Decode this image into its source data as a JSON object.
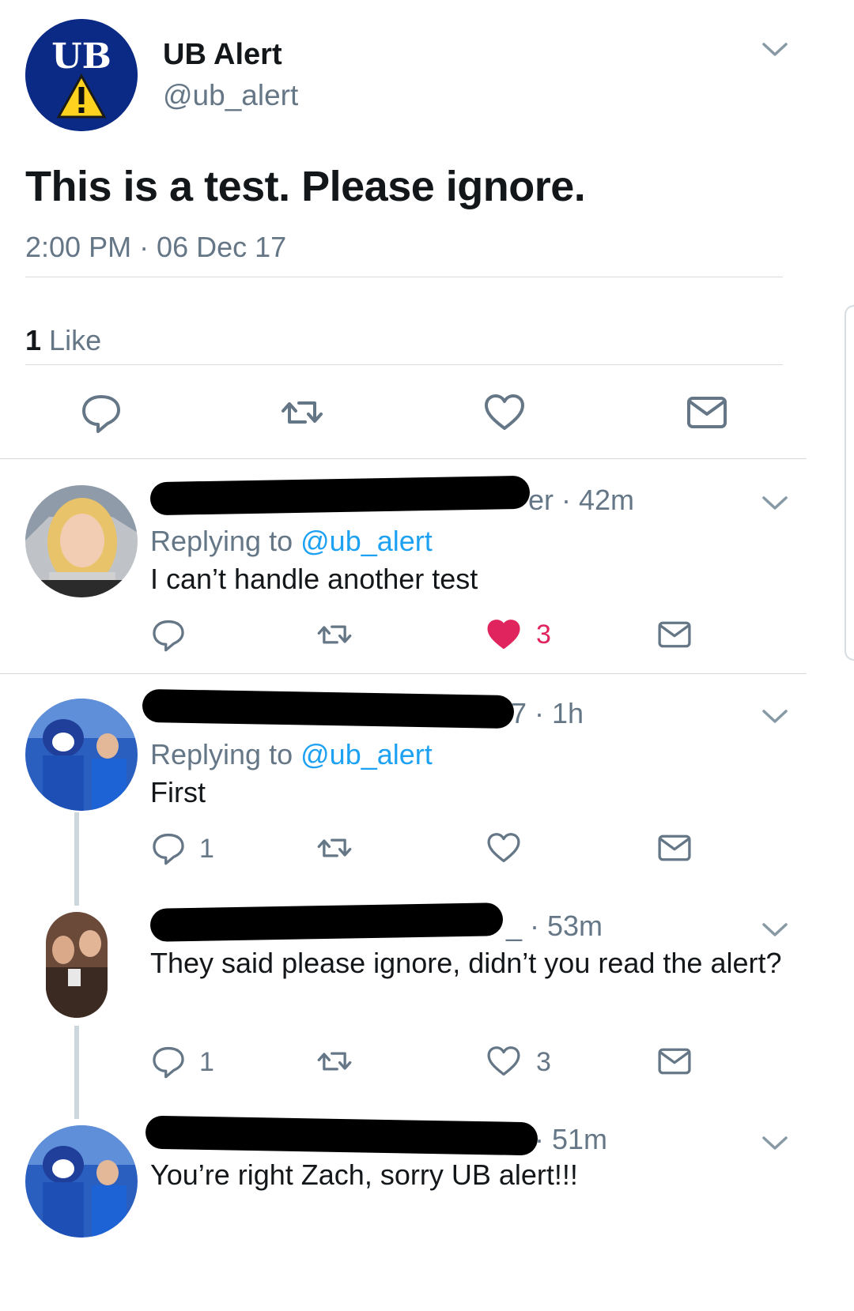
{
  "main_tweet": {
    "name": "UB Alert",
    "handle": "@ub_alert",
    "text": "This is a test. Please ignore.",
    "timestamp": "2:00 PM · 06 Dec 17",
    "like_count": "1",
    "like_label": "Like",
    "avatar_logo": "UB"
  },
  "replies": [
    {
      "meta_suffix": "er · 42m",
      "replying_prefix": "Replying to",
      "replying_handle": "@ub_alert",
      "text": "I can’t handle another test",
      "reply_count": "",
      "like_count": "3",
      "liked": true
    },
    {
      "meta_suffix": "7 · 1h",
      "replying_prefix": "Replying to",
      "replying_handle": "@ub_alert",
      "text": "First",
      "reply_count": "1",
      "like_count": "",
      "liked": false
    },
    {
      "meta_suffix": "_ · 53m",
      "text": "They said please ignore, didn’t you read the alert?",
      "reply_count": "1",
      "like_count": "3",
      "liked": false
    },
    {
      "meta_suffix": "· 51m",
      "text": "You’re right Zach, sorry UB alert!!!"
    }
  ],
  "icons": {
    "reply": "reply-icon",
    "retweet": "retweet-icon",
    "like": "heart-icon",
    "dm": "envelope-icon",
    "more": "chevron-down-icon"
  },
  "colors": {
    "primary_text": "#14171a",
    "secondary_text": "#657786",
    "link": "#1da1f2",
    "liked": "#e0245e",
    "divider": "#d6dce0"
  }
}
